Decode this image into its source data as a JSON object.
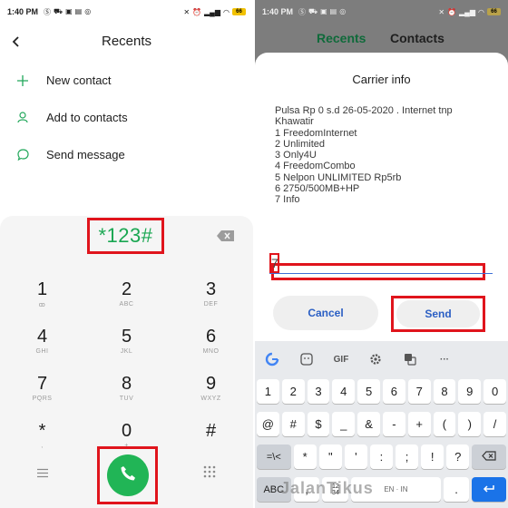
{
  "left": {
    "status": {
      "time": "1:40 PM",
      "battery": "66"
    },
    "header": {
      "title": "Recents"
    },
    "actions": [
      {
        "label": "New contact",
        "icon": "plus-icon"
      },
      {
        "label": "Add to contacts",
        "icon": "person-icon"
      },
      {
        "label": "Send message",
        "icon": "chat-bubble-icon"
      }
    ],
    "dialpad": {
      "display": "*123#",
      "keys": [
        {
          "digit": "1",
          "letters": "ꝏ"
        },
        {
          "digit": "2",
          "letters": "ABC"
        },
        {
          "digit": "3",
          "letters": "DEF"
        },
        {
          "digit": "4",
          "letters": "GHI"
        },
        {
          "digit": "5",
          "letters": "JKL"
        },
        {
          "digit": "6",
          "letters": "MNO"
        },
        {
          "digit": "7",
          "letters": "PQRS"
        },
        {
          "digit": "8",
          "letters": "TUV"
        },
        {
          "digit": "9",
          "letters": "WXYZ"
        },
        {
          "digit": "*",
          "letters": ","
        },
        {
          "digit": "0",
          "letters": "+"
        },
        {
          "digit": "#",
          "letters": ""
        }
      ]
    }
  },
  "right": {
    "status": {
      "time": "1:40 PM",
      "battery": "66"
    },
    "tabs": {
      "recents": "Recents",
      "contacts": "Contacts"
    },
    "dialog": {
      "title": "Carrier info",
      "message_lines": [
        "Pulsa Rp 0 s.d 26-05-2020 . Internet tnp",
        "Khawatir",
        "1 FreedomInternet",
        "2 Unlimited",
        "3 Only4U",
        "4 FreedomCombo",
        "5 Nelpon UNLIMITED Rp5rb",
        "6 2750/500MB+HP",
        "7 Info"
      ],
      "reply_value": "7",
      "cancel_label": "Cancel",
      "send_label": "Send"
    },
    "keyboard": {
      "toolbar": [
        "G",
        "sticker",
        "GIF",
        "settings",
        "translate",
        "..."
      ],
      "gif_label": "GIF",
      "more_label": "···",
      "row_numbers": [
        "1",
        "2",
        "3",
        "4",
        "5",
        "6",
        "7",
        "8",
        "9",
        "0"
      ],
      "row_symbols1": [
        "@",
        "#",
        "$",
        "_",
        "&",
        "-",
        "+",
        "(",
        ")",
        "/"
      ],
      "row_symbols2_left": "=\\<",
      "row_symbols2": [
        "*",
        "\"",
        "'",
        ":",
        ";",
        "!",
        "?"
      ],
      "abc_label": "ABC",
      "comma_label": ",",
      "num_key_label": "12\n34",
      "space_label": "EN · IN",
      "period_label": "."
    },
    "watermark": "JalanTikus"
  }
}
